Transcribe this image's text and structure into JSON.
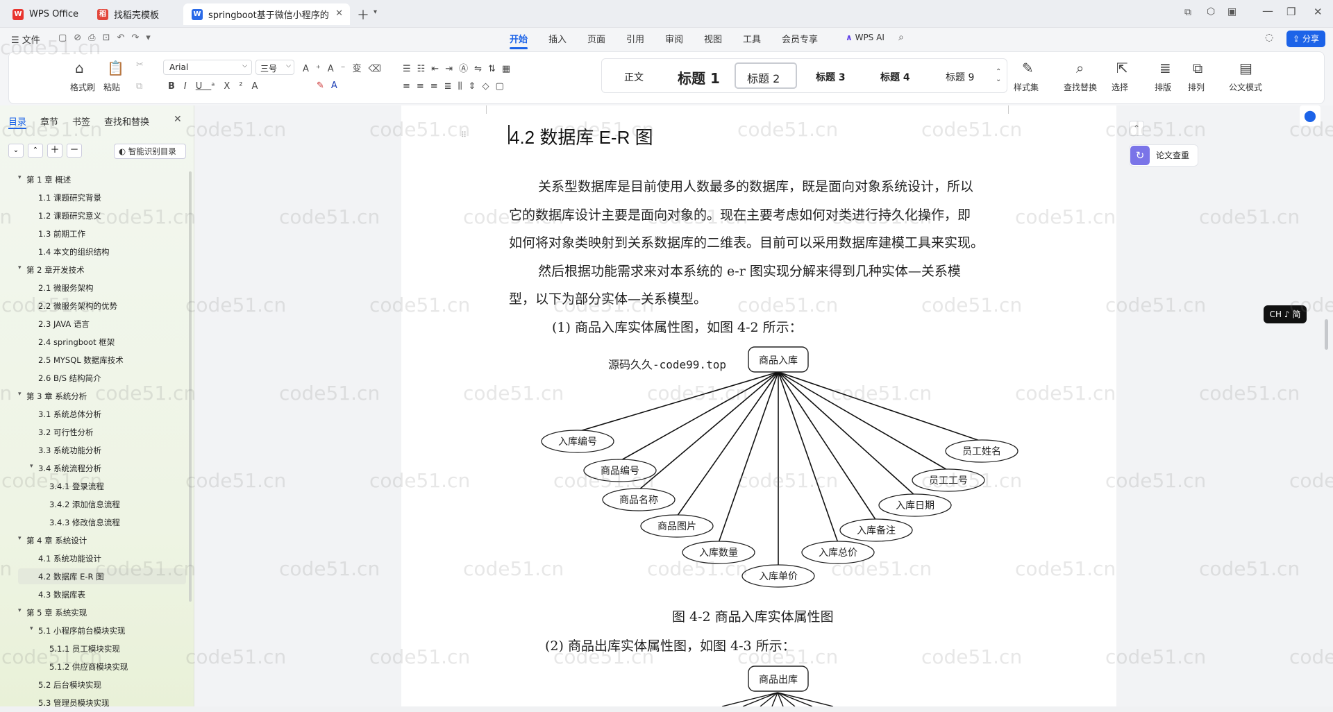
{
  "tabs": [
    {
      "label": "WPS Office"
    },
    {
      "label": "找稻壳模板"
    },
    {
      "label": "springboot基于微信小程序的"
    }
  ],
  "menubar": {
    "file": "文件",
    "items": [
      "开始",
      "插入",
      "页面",
      "引用",
      "审阅",
      "视图",
      "工具",
      "会员专享"
    ],
    "wps_ai": "WPS AI",
    "share": "分享"
  },
  "ribbon": {
    "format_painter": "格式刷",
    "paste": "粘贴",
    "font_name": "Arial",
    "font_size": "三号",
    "styles": [
      "正文",
      "标题 1",
      "标题 2",
      "标题 3",
      "标题 4",
      "标题 9"
    ],
    "style_set": "样式集",
    "find_replace": "查找替换",
    "select": "选择",
    "layout": "排版",
    "arrange": "排列",
    "official_mode": "公文模式"
  },
  "sidebar": {
    "tabs": [
      "目录",
      "章节",
      "书签",
      "查找和替换"
    ],
    "smart_toc": "智能识别目录",
    "toc": [
      {
        "label": "第 1 章  概述",
        "level": 1,
        "expand": true
      },
      {
        "label": "1.1 课题研究背景",
        "level": 2
      },
      {
        "label": "1.2 课题研究意义",
        "level": 2
      },
      {
        "label": "1.3 前期工作",
        "level": 2
      },
      {
        "label": "1.4 本文的组织结构",
        "level": 2
      },
      {
        "label": "第 2 章开发技术",
        "level": 1,
        "expand": true
      },
      {
        "label": "2.1 微服务架构",
        "level": 2
      },
      {
        "label": "2.2 微服务架构的优势",
        "level": 2
      },
      {
        "label": "2.3 JAVA 语言",
        "level": 2
      },
      {
        "label": "2.4 springboot 框架",
        "level": 2
      },
      {
        "label": "2.5 MYSQL 数据库技术",
        "level": 2
      },
      {
        "label": "2.6 B/S 结构简介",
        "level": 2
      },
      {
        "label": "第 3 章  系统分析",
        "level": 1,
        "expand": true
      },
      {
        "label": "3.1 系统总体分析",
        "level": 2
      },
      {
        "label": "3.2 可行性分析",
        "level": 2
      },
      {
        "label": "3.3 系统功能分析",
        "level": 2
      },
      {
        "label": "3.4 系统流程分析",
        "level": 2,
        "expand": true
      },
      {
        "label": "3.4.1 登录流程",
        "level": 3
      },
      {
        "label": "3.4.2 添加信息流程",
        "level": 3
      },
      {
        "label": "3.4.3 修改信息流程",
        "level": 3
      },
      {
        "label": "第 4 章  系统设计",
        "level": 1,
        "expand": true
      },
      {
        "label": "4.1 系统功能设计",
        "level": 2
      },
      {
        "label": "4.2 数据库 E-R 图",
        "level": 2,
        "selected": true
      },
      {
        "label": "4.3 数据库表",
        "level": 2
      },
      {
        "label": "第 5 章  系统实现",
        "level": 1,
        "expand": true
      },
      {
        "label": "5.1 小程序前台模块实现",
        "level": 2,
        "expand": true
      },
      {
        "label": "5.1.1 员工模块实现",
        "level": 3
      },
      {
        "label": "5.1.2 供应商模块实现",
        "level": 3
      },
      {
        "label": "5.2 后台模块实现",
        "level": 2
      },
      {
        "label": "5.3 管理员模块实现",
        "level": 2
      }
    ]
  },
  "document": {
    "heading": "4.2 数据库 E-R 图",
    "para1_l1": "关系型数据库是目前使用人数最多的数据库，既是面向对象系统设计，所以",
    "para1_l2": "它的数据库设计主要是面向对象的。现在主要考虑如何对类进行持久化操作，即",
    "para1_l3": "如何将对象类映射到关系数据库的二维表。目前可以采用数据库建模工具来实现。",
    "para2_l1": "然后根据功能需求来对本系统的 e-r 图实现分解来得到几种实体—关系模",
    "para2_l2": "型，以下为部分实体—关系模型。",
    "item1": "(1) 商品入库实体属性图，如图 4-2 所示：",
    "source_mark": "源码久久-code99.top",
    "entity1": "商品入库",
    "attributes1": [
      "入库编号",
      "商品编号",
      "商品名称",
      "商品图片",
      "入库数量",
      "入库单价",
      "入库总价",
      "入库备注",
      "入库日期",
      "员工工号",
      "员工姓名"
    ],
    "caption1": "图 4-2 商品入库实体属性图",
    "item2": "(2) 商品出库实体属性图，如图 4-3 所示：",
    "entity2": "商品出库"
  },
  "right_panel": {
    "paper_check": "论文查重",
    "ime": "CH ♪ 简"
  },
  "watermark": "code51.cn"
}
